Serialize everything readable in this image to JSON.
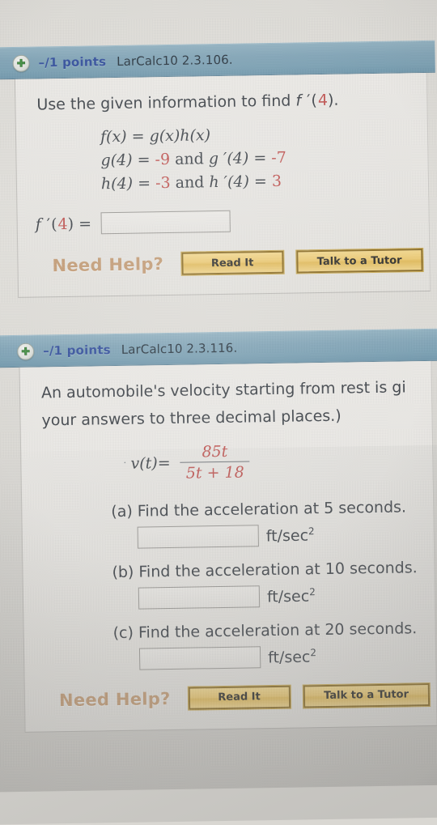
{
  "problems": [
    {
      "points_label": "–/1 points",
      "question_id": "LarCalc10 2.3.106.",
      "expand_icon": "plus-icon",
      "prompt": "Use the given information to find f ′(4).",
      "prompt_parts": {
        "lead": "Use the given information to find ",
        "fn": "f",
        "prime": " ′(",
        "arg": "4",
        "tail": ")."
      },
      "given": [
        {
          "lhs": "f(x)",
          "eq": " = ",
          "rhs": "g(x)h(x)"
        },
        {
          "lhs": "g(4)",
          "eq": " = ",
          "rhs": "-9",
          "conj": " and ",
          "lhs2": "g ′(4)",
          "eq2": " = ",
          "rhs2": "-7"
        },
        {
          "lhs": "h(4)",
          "eq": " = ",
          "rhs": "-3",
          "conj": " and ",
          "lhs2": "h ′(4)",
          "eq2": " = ",
          "rhs2": "3"
        }
      ],
      "answer_label_fn": "f",
      "answer_label_prime": " ′(",
      "answer_label_arg": "4",
      "answer_label_tail": ") =",
      "answer_value": "",
      "answer_placeholder": "",
      "help": {
        "label": "Need Help?",
        "read_it": "Read It",
        "talk_to_tutor": "Talk to a Tutor"
      }
    },
    {
      "points_label": "–/1 points",
      "question_id": "LarCalc10 2.3.116.",
      "expand_icon": "plus-icon",
      "prompt_line1": "An automobile's velocity starting from rest is gi",
      "prompt_line2": "your answers to three decimal places.)",
      "formula": {
        "lhs": "v(t)",
        "eq": " = ",
        "numerator": "85t",
        "denominator": "5t + 18"
      },
      "subquestions": [
        {
          "label": "(a) Find the acceleration at 5 seconds.",
          "value": "",
          "unit_base": "ft/sec",
          "unit_exp": "2"
        },
        {
          "label": "(b) Find the acceleration at 10 seconds.",
          "value": "",
          "unit_base": "ft/sec",
          "unit_exp": "2"
        },
        {
          "label": "(c) Find the acceleration at 20 seconds.",
          "value": "",
          "unit_base": "ft/sec",
          "unit_exp": "2"
        }
      ],
      "help": {
        "label": "Need Help?",
        "read_it": "Read It",
        "talk_to_tutor": "Talk to a Tutor"
      }
    }
  ],
  "colors": {
    "header_bar": "#7fa3b6",
    "points_text": "#2f4c9b",
    "math_red": "#c0504d",
    "need_help": "#c39a72",
    "button_gold": "#edc96f",
    "panel_bg": "#eceae6",
    "page_bg": "#ded de0"
  }
}
